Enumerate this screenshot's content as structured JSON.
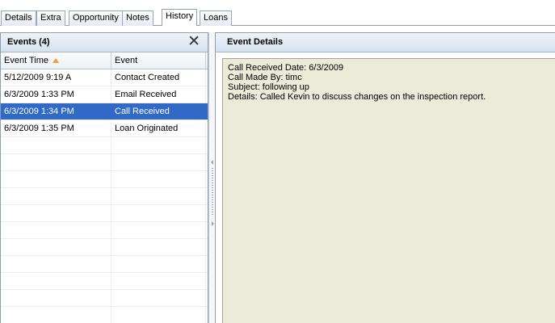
{
  "tabs": [
    {
      "label": "Details",
      "active": false
    },
    {
      "label": "Extra",
      "active": false
    },
    {
      "label": "Opportunity",
      "active": false
    },
    {
      "label": "Notes",
      "active": false
    },
    {
      "label": "History",
      "active": true
    },
    {
      "label": "Loans",
      "active": false
    }
  ],
  "events_panel": {
    "title": "Events (4)",
    "close_icon": "close-x-icon",
    "columns": {
      "event_time": "Event Time",
      "event": "Event"
    },
    "sort": {
      "column": "event_time",
      "direction": "ascending",
      "icon": "sort-asc-icon",
      "color": "#f0a030"
    },
    "rows": [
      {
        "time": "5/12/2009 9:19 A",
        "event": "Contact Created"
      },
      {
        "time": "6/3/2009 1:33 PM",
        "event": "Email Received"
      },
      {
        "time": "6/3/2009 1:34 PM",
        "event": "Call Received"
      },
      {
        "time": "6/3/2009 1:35 PM",
        "event": "Loan Originated"
      }
    ],
    "selected_row": 2,
    "selection_color": "#3169c6"
  },
  "details_panel": {
    "title": "Event Details",
    "lines": [
      "Call Received Date: 6/3/2009",
      "Call Made By: timc",
      "Subject: following up",
      "Details: Called Kevin to discuss changes on the inspection report."
    ],
    "background_color": "#ecead9"
  }
}
